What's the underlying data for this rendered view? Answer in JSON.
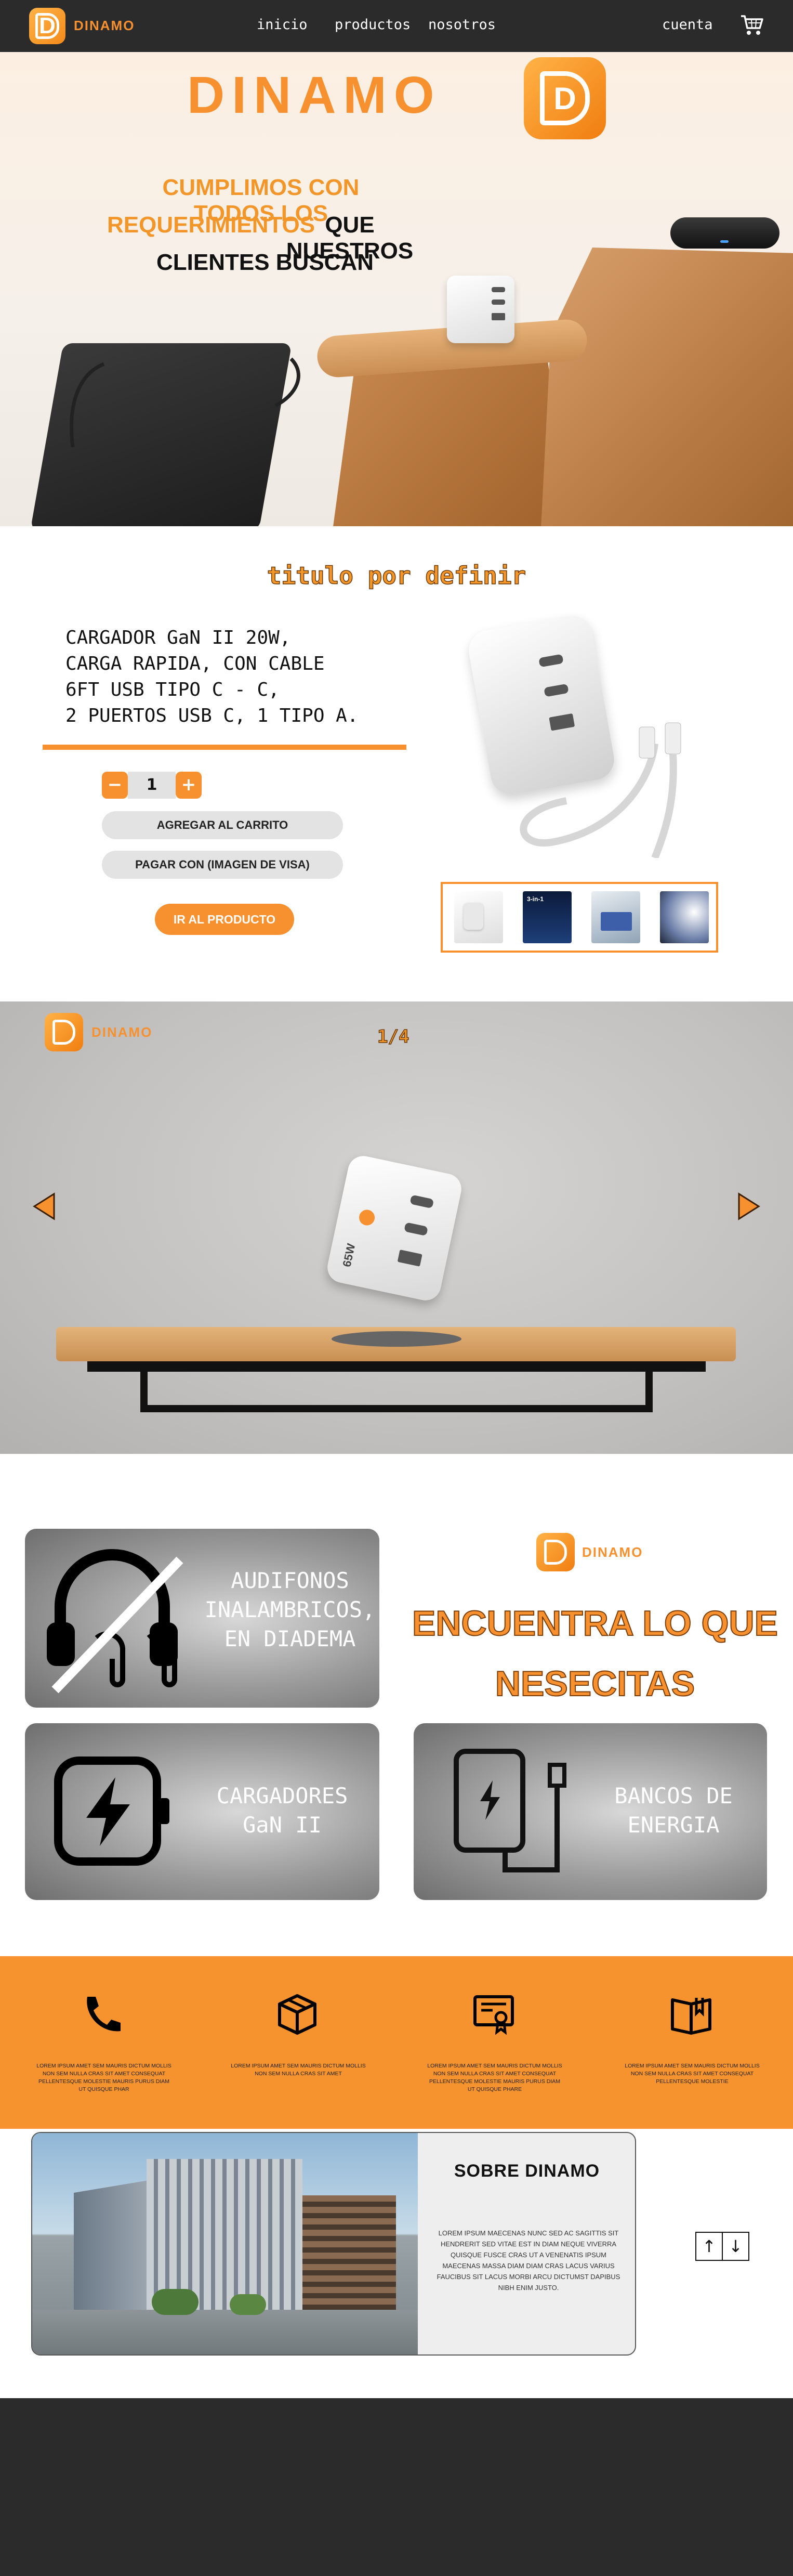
{
  "nav": {
    "brand": "DINAMO",
    "logo_letter": "D",
    "links": [
      "inicio",
      "productos",
      "nosotros"
    ],
    "account": "cuenta"
  },
  "hero": {
    "title": "DINAMO",
    "tagline_orange_1": "CUMPLIMOS CON TODOS LOS",
    "tagline_orange_2": "REQUERIMIENTOS",
    "tagline_black_1": "QUE NUESTROS",
    "tagline_black_2": "CLIENTES BUSCAN"
  },
  "product": {
    "section_title": "titulo por definir",
    "description_lines": [
      "CARGADOR GaN II 20W,",
      "CARGA RAPIDA, CON CABLE",
      "6FT USB TIPO C - C,",
      "2 PUERTOS USB C, 1 TIPO A."
    ],
    "qty_minus": "−",
    "qty_value": "1",
    "qty_plus": "+",
    "add_to_cart": "AGREGAR AL CARRITO",
    "pay_with": "PAGAR CON (IMAGEN DE VISA)",
    "go_to_product": "IR AL PRODUCTO",
    "thumb_badge": "3-in-1"
  },
  "slider": {
    "brand": "DINAMO",
    "counter": "1/4",
    "charger_badge": "65W"
  },
  "categories": {
    "headphones": [
      "AUDIFONOS",
      "INALAMBRICOS,",
      "EN DIADEMA"
    ],
    "chargers": [
      "CARGADORES",
      "GaN II"
    ],
    "powerbanks": [
      "BANCOS DE",
      "ENERGIA"
    ],
    "find_brand": "DINAMO",
    "find_title_1": "ENCUENTRA LO QUE",
    "find_title_2": "NESECITAS"
  },
  "features": [
    {
      "icon": "phone-icon",
      "text": "LOREM IPSUM AMET SEM MAURIS DICTUM MOLLIS NON SEM NULLA CRAS SIT AMET CONSEQUAT PELLENTESQUE MOLESTIE MAURIS PURUS DIAM UT QUISQUE PHAR"
    },
    {
      "icon": "box-icon",
      "text": "LOREM IPSUM AMET SEM MAURIS DICTUM MOLLIS NON SEM NULLA CRAS SIT AMET"
    },
    {
      "icon": "certificate-icon",
      "text": "LOREM IPSUM AMET SEM MAURIS DICTUM MOLLIS NON SEM NULLA CRAS SIT AMET CONSEQUAT PELLENTESQUE MOLESTIE MAURIS PURUS DIAM UT QUISQUE PHARE"
    },
    {
      "icon": "book-icon",
      "text": "LOREM IPSUM AMET SEM MAURIS DICTUM MOLLIS NON SEM NULLA CRAS SIT AMET CONSEQUAT PELLENTESQUE MOLESTIE"
    }
  ],
  "about": {
    "title": "SOBRE DINAMO",
    "text": "LOREM IPSUM MAECENAS NUNC SED AC SAGITTIS SIT HENDRERIT SED VITAE EST IN DIAM NEQUE VIVERRA QUISQUE FUSCE CRAS UT A VENENATIS IPSUM MAECENAS MASSA DIAM DIAM CRAS LACUS VARIUS FAUCIBUS SIT LACUS MORBI ARCU DICTUMST DAPIBUS NIBH ENIM JUSTO.",
    "scroll_up": "↑",
    "scroll_down": "↓"
  },
  "colors": {
    "accent": "#f7902e",
    "nav_bg": "#2b2b2b",
    "footer_bg": "#2b2b2b"
  }
}
